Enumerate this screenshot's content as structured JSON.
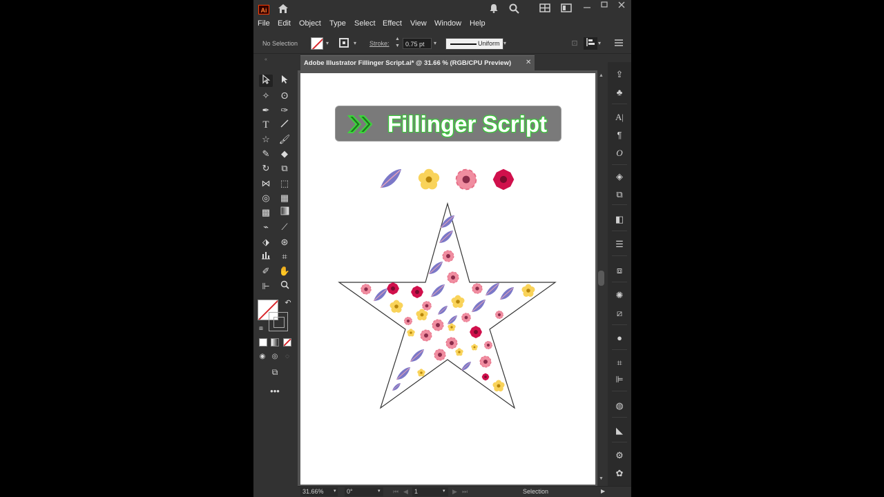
{
  "app": {
    "logo": "Ai",
    "menu": [
      "File",
      "Edit",
      "Object",
      "Type",
      "Select",
      "Effect",
      "View",
      "Window",
      "Help"
    ],
    "titlebar_icons": [
      "home-icon",
      "bell-icon",
      "search-icon",
      "arrange-icon",
      "workspace-icon",
      "minimize-icon",
      "maximize-icon",
      "close-icon"
    ]
  },
  "control": {
    "selection_state": "No Selection",
    "stroke_label": "Stroke:",
    "stroke_value": "0.75 pt",
    "profile_label": "Uniform"
  },
  "document": {
    "tab_title": "Adobe Illustrator Fillinger Script.ai* @ 31.66 % (RGB/CPU Preview)",
    "close_glyph": "✕"
  },
  "artboard": {
    "banner_text": "Fillinger Script",
    "banner_accent": "#3cd63c",
    "source_items": [
      "leaf",
      "yellow-flower",
      "pink-flower",
      "magenta-flower"
    ],
    "fill_shape": "star",
    "colors": {
      "pink": "#f08da0",
      "magenta": "#d0104c",
      "yellow": "#f9d35a",
      "leaf": "#7b78c8"
    }
  },
  "status": {
    "zoom": "31.66%",
    "rotation": "0°",
    "artboard_number": "1",
    "tool_name": "Selection"
  }
}
